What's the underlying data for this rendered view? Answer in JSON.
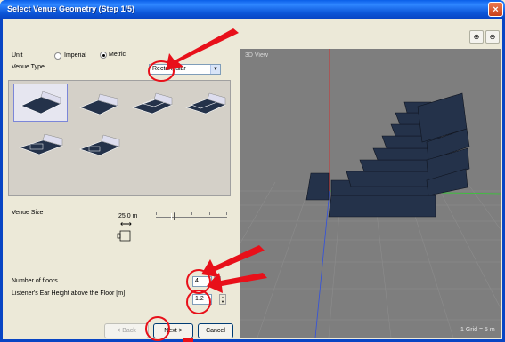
{
  "window": {
    "title": "Select Venue Geometry (Step 1/5)",
    "close_glyph": "×"
  },
  "unit": {
    "label": "Unit",
    "options": [
      {
        "label": "Imperial",
        "checked": false
      },
      {
        "label": "Metric",
        "checked": true
      }
    ]
  },
  "venue_type": {
    "label": "Venue Type",
    "selected": "Rectangular",
    "arrow": "▼"
  },
  "thumbnails": [
    {
      "name": "shape-1",
      "selected": true
    },
    {
      "name": "shape-2",
      "selected": false
    },
    {
      "name": "shape-3",
      "selected": false
    },
    {
      "name": "shape-4",
      "selected": false
    },
    {
      "name": "shape-5",
      "selected": false
    },
    {
      "name": "shape-6",
      "selected": false
    }
  ],
  "venue_size": {
    "label": "Venue Size",
    "value": "25.0 m",
    "arrow": "⟷"
  },
  "floors": {
    "label": "Number of floors",
    "value": "4"
  },
  "ear_height": {
    "label": "Listener's Ear Height above the Floor [m]",
    "value": "1.2"
  },
  "buttons": {
    "back": "< Back",
    "next": "Next >",
    "cancel": "Cancel"
  },
  "zoom": {
    "in": "⊕",
    "out": "⊖"
  },
  "view": {
    "label": "3D View",
    "grid_note": "1 Grid = 5 m"
  },
  "colors": {
    "title_bar": "#0a5ee8",
    "annotation": "#e8101a",
    "venue_fill": "#24324a"
  }
}
